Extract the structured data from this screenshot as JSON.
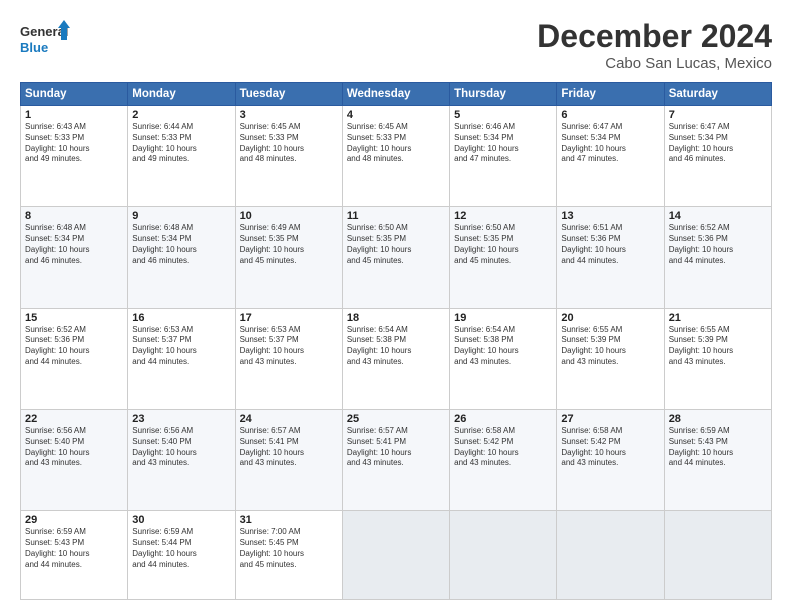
{
  "header": {
    "logo_line1": "General",
    "logo_line2": "Blue",
    "main_title": "December 2024",
    "subtitle": "Cabo San Lucas, Mexico"
  },
  "calendar": {
    "headers": [
      "Sunday",
      "Monday",
      "Tuesday",
      "Wednesday",
      "Thursday",
      "Friday",
      "Saturday"
    ],
    "rows": [
      [
        {
          "num": "1",
          "info": "Sunrise: 6:43 AM\nSunset: 5:33 PM\nDaylight: 10 hours\nand 49 minutes."
        },
        {
          "num": "2",
          "info": "Sunrise: 6:44 AM\nSunset: 5:33 PM\nDaylight: 10 hours\nand 49 minutes."
        },
        {
          "num": "3",
          "info": "Sunrise: 6:45 AM\nSunset: 5:33 PM\nDaylight: 10 hours\nand 48 minutes."
        },
        {
          "num": "4",
          "info": "Sunrise: 6:45 AM\nSunset: 5:33 PM\nDaylight: 10 hours\nand 48 minutes."
        },
        {
          "num": "5",
          "info": "Sunrise: 6:46 AM\nSunset: 5:34 PM\nDaylight: 10 hours\nand 47 minutes."
        },
        {
          "num": "6",
          "info": "Sunrise: 6:47 AM\nSunset: 5:34 PM\nDaylight: 10 hours\nand 47 minutes."
        },
        {
          "num": "7",
          "info": "Sunrise: 6:47 AM\nSunset: 5:34 PM\nDaylight: 10 hours\nand 46 minutes."
        }
      ],
      [
        {
          "num": "8",
          "info": "Sunrise: 6:48 AM\nSunset: 5:34 PM\nDaylight: 10 hours\nand 46 minutes."
        },
        {
          "num": "9",
          "info": "Sunrise: 6:48 AM\nSunset: 5:34 PM\nDaylight: 10 hours\nand 46 minutes."
        },
        {
          "num": "10",
          "info": "Sunrise: 6:49 AM\nSunset: 5:35 PM\nDaylight: 10 hours\nand 45 minutes."
        },
        {
          "num": "11",
          "info": "Sunrise: 6:50 AM\nSunset: 5:35 PM\nDaylight: 10 hours\nand 45 minutes."
        },
        {
          "num": "12",
          "info": "Sunrise: 6:50 AM\nSunset: 5:35 PM\nDaylight: 10 hours\nand 45 minutes."
        },
        {
          "num": "13",
          "info": "Sunrise: 6:51 AM\nSunset: 5:36 PM\nDaylight: 10 hours\nand 44 minutes."
        },
        {
          "num": "14",
          "info": "Sunrise: 6:52 AM\nSunset: 5:36 PM\nDaylight: 10 hours\nand 44 minutes."
        }
      ],
      [
        {
          "num": "15",
          "info": "Sunrise: 6:52 AM\nSunset: 5:36 PM\nDaylight: 10 hours\nand 44 minutes."
        },
        {
          "num": "16",
          "info": "Sunrise: 6:53 AM\nSunset: 5:37 PM\nDaylight: 10 hours\nand 44 minutes."
        },
        {
          "num": "17",
          "info": "Sunrise: 6:53 AM\nSunset: 5:37 PM\nDaylight: 10 hours\nand 43 minutes."
        },
        {
          "num": "18",
          "info": "Sunrise: 6:54 AM\nSunset: 5:38 PM\nDaylight: 10 hours\nand 43 minutes."
        },
        {
          "num": "19",
          "info": "Sunrise: 6:54 AM\nSunset: 5:38 PM\nDaylight: 10 hours\nand 43 minutes."
        },
        {
          "num": "20",
          "info": "Sunrise: 6:55 AM\nSunset: 5:39 PM\nDaylight: 10 hours\nand 43 minutes."
        },
        {
          "num": "21",
          "info": "Sunrise: 6:55 AM\nSunset: 5:39 PM\nDaylight: 10 hours\nand 43 minutes."
        }
      ],
      [
        {
          "num": "22",
          "info": "Sunrise: 6:56 AM\nSunset: 5:40 PM\nDaylight: 10 hours\nand 43 minutes."
        },
        {
          "num": "23",
          "info": "Sunrise: 6:56 AM\nSunset: 5:40 PM\nDaylight: 10 hours\nand 43 minutes."
        },
        {
          "num": "24",
          "info": "Sunrise: 6:57 AM\nSunset: 5:41 PM\nDaylight: 10 hours\nand 43 minutes."
        },
        {
          "num": "25",
          "info": "Sunrise: 6:57 AM\nSunset: 5:41 PM\nDaylight: 10 hours\nand 43 minutes."
        },
        {
          "num": "26",
          "info": "Sunrise: 6:58 AM\nSunset: 5:42 PM\nDaylight: 10 hours\nand 43 minutes."
        },
        {
          "num": "27",
          "info": "Sunrise: 6:58 AM\nSunset: 5:42 PM\nDaylight: 10 hours\nand 43 minutes."
        },
        {
          "num": "28",
          "info": "Sunrise: 6:59 AM\nSunset: 5:43 PM\nDaylight: 10 hours\nand 44 minutes."
        }
      ],
      [
        {
          "num": "29",
          "info": "Sunrise: 6:59 AM\nSunset: 5:43 PM\nDaylight: 10 hours\nand 44 minutes."
        },
        {
          "num": "30",
          "info": "Sunrise: 6:59 AM\nSunset: 5:44 PM\nDaylight: 10 hours\nand 44 minutes."
        },
        {
          "num": "31",
          "info": "Sunrise: 7:00 AM\nSunset: 5:45 PM\nDaylight: 10 hours\nand 45 minutes."
        },
        {
          "num": "",
          "info": ""
        },
        {
          "num": "",
          "info": ""
        },
        {
          "num": "",
          "info": ""
        },
        {
          "num": "",
          "info": ""
        }
      ]
    ]
  }
}
